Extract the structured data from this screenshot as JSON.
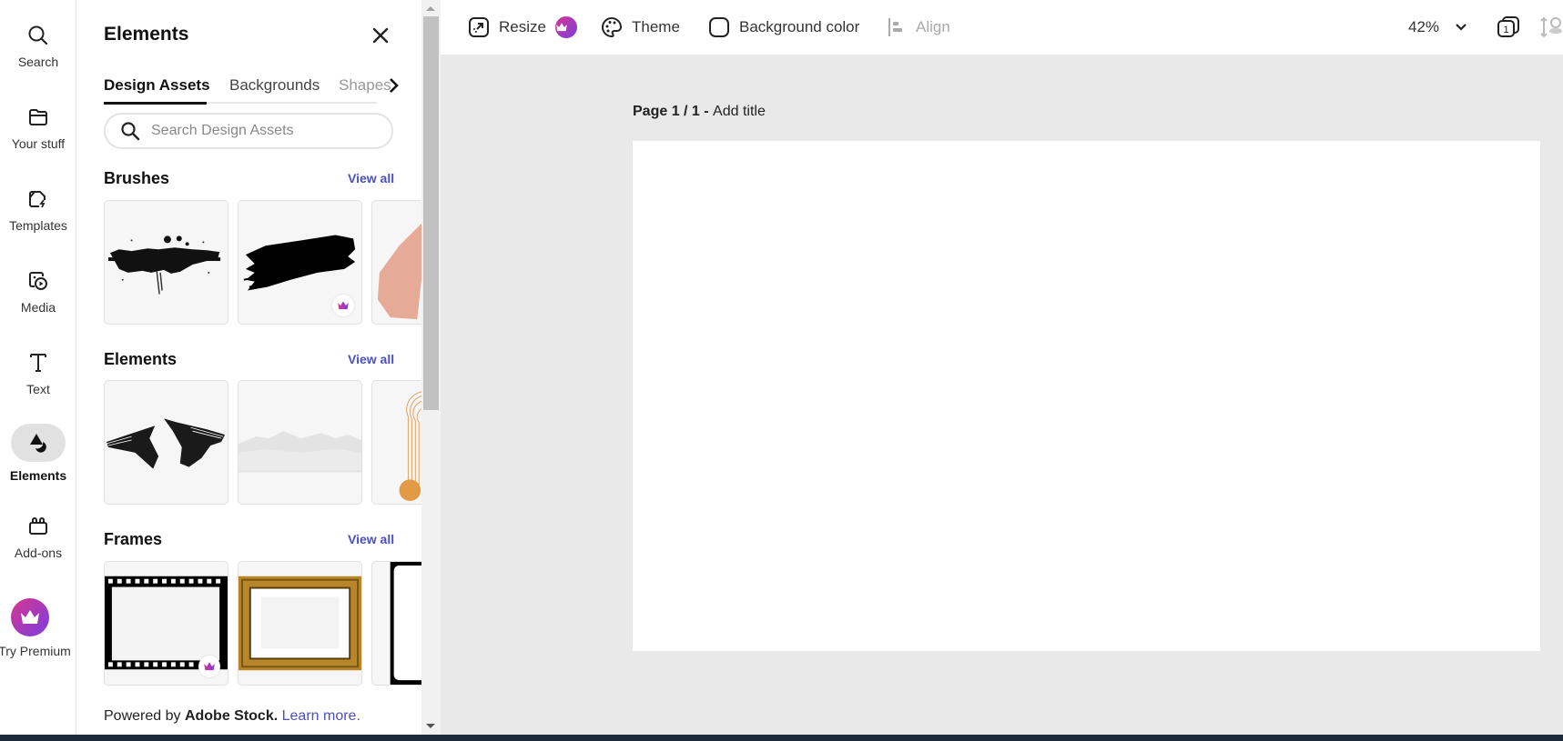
{
  "rail": {
    "items": [
      {
        "label": "Search",
        "icon": "search-icon"
      },
      {
        "label": "Your stuff",
        "icon": "folder-icon"
      },
      {
        "label": "Templates",
        "icon": "templates-icon"
      },
      {
        "label": "Media",
        "icon": "media-icon"
      },
      {
        "label": "Text",
        "icon": "text-icon"
      },
      {
        "label": "Elements",
        "icon": "elements-icon",
        "active": true
      },
      {
        "label": "Add-ons",
        "icon": "addons-icon"
      },
      {
        "label": "Try Premium",
        "icon": "crown-icon"
      }
    ]
  },
  "panel": {
    "title": "Elements",
    "tabs": [
      {
        "label": "Design Assets",
        "active": true
      },
      {
        "label": "Backgrounds"
      },
      {
        "label": "Shapes"
      }
    ],
    "search": {
      "placeholder": "Search Design Assets",
      "value": ""
    },
    "sections": [
      {
        "title": "Brushes",
        "view_all": "View all",
        "items": [
          "Grunge splatter brush stroke",
          "Black paint brush stroke (premium)",
          "Peach brush stroke"
        ]
      },
      {
        "title": "Elements",
        "view_all": "View all",
        "items": [
          "Black wavy abstract shape",
          "White mountain landscape",
          "Orange arch lines with circle"
        ]
      },
      {
        "title": "Frames",
        "view_all": "View all",
        "items": [
          "Film strip grunge frame (premium)",
          "Gold ornate picture frame",
          "Black rough frame"
        ]
      }
    ],
    "footer": {
      "prefix": "Powered by ",
      "brand": "Adobe Stock.",
      "link": "Learn more."
    }
  },
  "toolbar": {
    "resize": "Resize",
    "theme": "Theme",
    "background_color": "Background color",
    "align": "Align",
    "zoom": "42%",
    "page_count": "1"
  },
  "canvas": {
    "page_prefix": "Page 1 / 1 - ",
    "page_title_placeholder": "Add title"
  },
  "colors": {
    "accent": "#4b4fc4",
    "premium_start": "#d6368f",
    "premium_end": "#7a3ee0",
    "canvas_bg": "#e9e9e9"
  }
}
